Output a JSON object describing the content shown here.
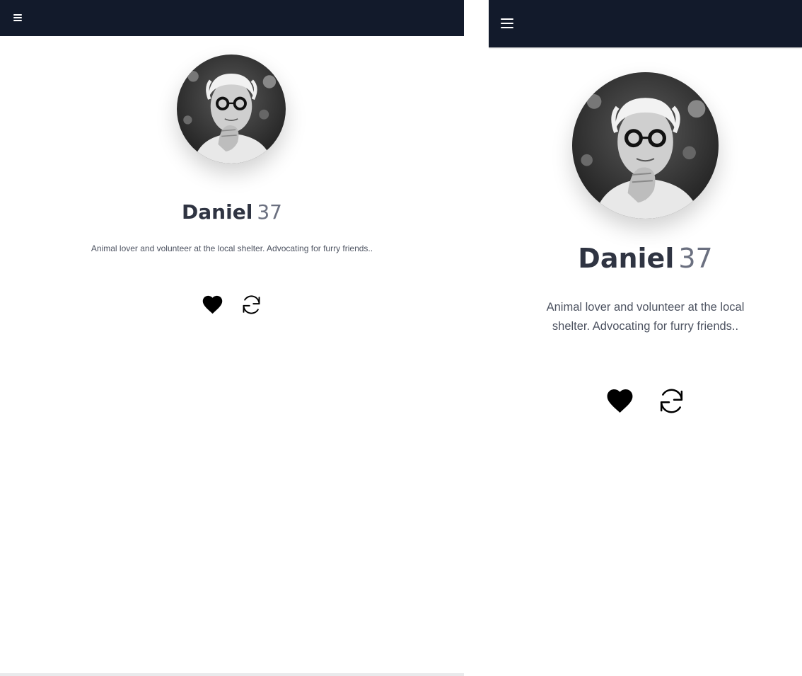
{
  "theme": {
    "nav_color": "#121a2b",
    "text_color": "#2f3442",
    "muted_color": "#6b7080"
  },
  "views": [
    {
      "id": "desktop",
      "menu_icon": "hamburger-menu-icon",
      "profile": {
        "name": "Daniel",
        "age": "37",
        "bio": "Animal lover and volunteer at the local shelter. Advocating for furry friends..",
        "avatar_icon": "profile-photo"
      },
      "actions": {
        "like_icon": "heart-icon",
        "refresh_icon": "refresh-icon"
      }
    },
    {
      "id": "mobile",
      "menu_icon": "hamburger-menu-icon",
      "profile": {
        "name": "Daniel",
        "age": "37",
        "bio": "Animal lover and volunteer at the local shelter. Advocating for furry friends..",
        "avatar_icon": "profile-photo"
      },
      "actions": {
        "like_icon": "heart-icon",
        "refresh_icon": "refresh-icon"
      }
    }
  ]
}
